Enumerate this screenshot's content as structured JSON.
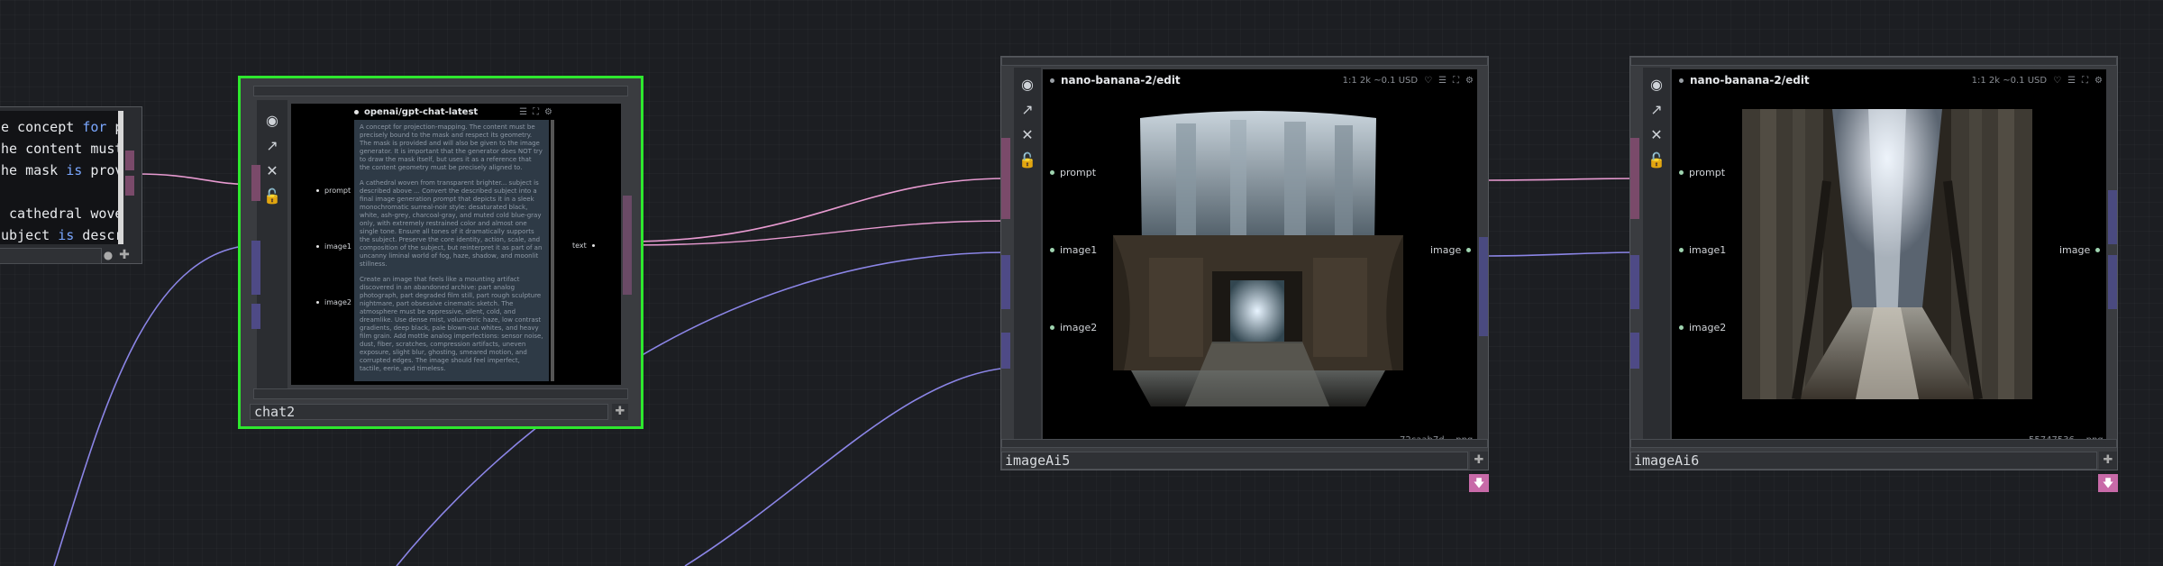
{
  "left_node": {
    "code_lines": [
      [
        {
          "t": "e concept "
        },
        {
          "t": "for",
          "kw": true
        },
        {
          "t": " pro"
        }
      ],
      [
        {
          "t": "he content must b"
        }
      ],
      [
        {
          "t": "he mask "
        },
        {
          "t": "is",
          "kw": true
        },
        {
          "t": " provi"
        }
      ],
      [
        {
          "t": ""
        }
      ],
      [
        {
          "t": " cathedral woven"
        }
      ],
      [
        {
          "t": "ubject "
        },
        {
          "t": "is",
          "kw": true
        },
        {
          "t": " descri"
        }
      ]
    ]
  },
  "chat_node": {
    "name": "chat2",
    "header_title": "openai/gpt-chat-latest",
    "inputs": [
      "prompt",
      "image1",
      "image2"
    ],
    "output": "text",
    "prompt_paragraphs": [
      "A concept for projection-mapping. The content must be precisely bound to the mask and respect its geometry. The mask is provided and will also be given to the image generator. It is important that the generator does NOT try to draw the mask itself, but uses it as a reference that the content geometry must be precisely aligned to.",
      "A cathedral woven from transparent brighter... subject is described above ... Convert the described subject into a final image generation prompt that depicts it in a sleek monochromatic surreal-noir style: desaturated black, white, ash-grey, charcoal-gray, and muted cold blue-gray only, with extremely restrained color and almost one single tone. Ensure all tones of it dramatically supports the subject. Preserve the core identity, action, scale, and composition of the subject, but reinterpret it as part of an uncanny liminal world of fog, haze, shadow, and moonlit stillness.",
      "Create an image that feels like a mounting artifact discovered in an abandoned archive: part analog photograph, part degraded film still, part rough sculpture nightmare, part obsessive cinematic sketch. The atmosphere must be oppressive, silent, cold, and dreamlike. Use dense mist, volumetric haze, low contrast gradients, deep black, pale blown-out whites, and heavy film grain. Add mottle analog imperfections: sensor noise, dust, fiber, scratches, compression artifacts, uneven exposure, slight blur, ghosting, smeared motion, and corrupted edges. The image should feel imperfect, tactile, eerie, and timeless."
    ]
  },
  "image_nodes": [
    {
      "name": "imageAi5",
      "header_title": "nano-banana-2/edit",
      "header_meta": "1:1 2k  ~0.1 USD",
      "inputs": [
        "prompt",
        "image1",
        "image2"
      ],
      "output": "image",
      "filename": "72caab7d....png"
    },
    {
      "name": "imageAi6",
      "header_title": "nano-banana-2/edit",
      "header_meta": "1:1 2k  ~0.1 USD",
      "inputs": [
        "prompt",
        "image1",
        "image2"
      ],
      "output": "image",
      "filename": "55747536....png"
    }
  ],
  "colors": {
    "background": "#1c1e22",
    "selected_outline": "#2ee82e",
    "wire_pink": "#e79ad0",
    "wire_violet": "#8b85e6",
    "port_pink": "#7a4a6a",
    "port_violet": "#4e4a86",
    "download_button": "#c86aa8"
  },
  "icons": [
    "eye-icon",
    "wand-icon",
    "close-icon",
    "lock-icon",
    "plus-icon",
    "download-icon",
    "heart-icon",
    "menu-icon",
    "expand-icon",
    "gear-icon"
  ]
}
